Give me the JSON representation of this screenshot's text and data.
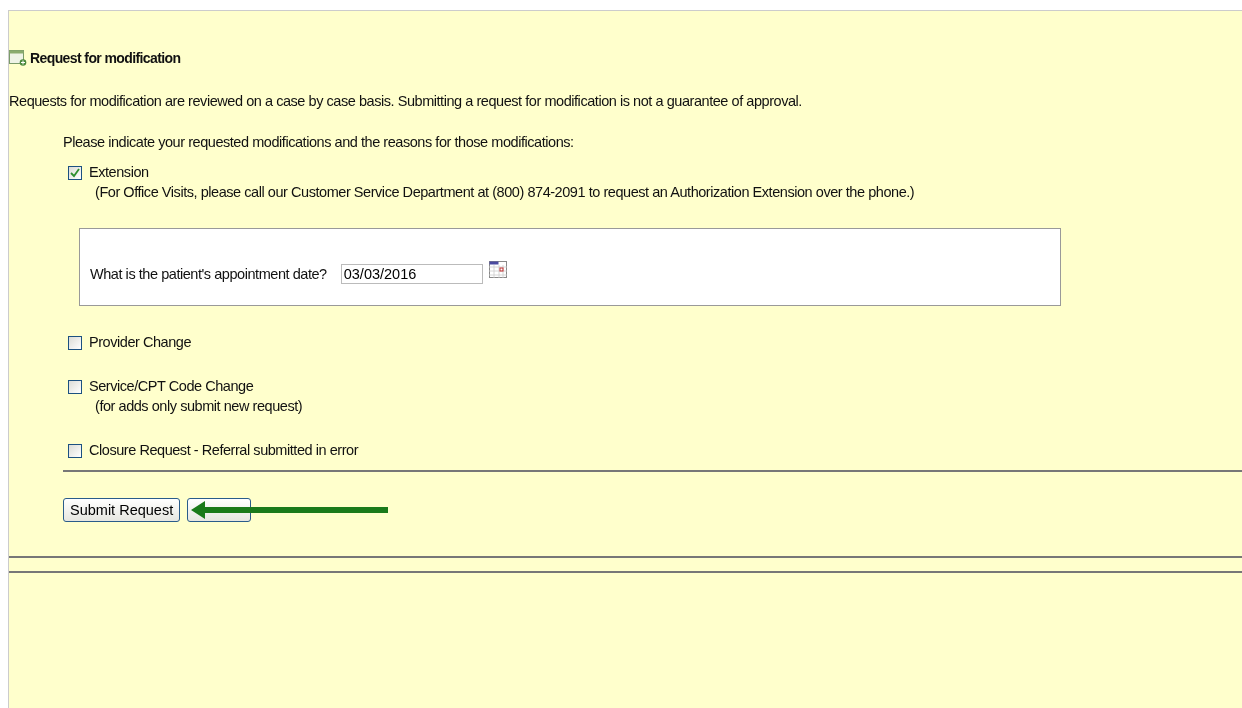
{
  "panel": {
    "title": "Request for modification"
  },
  "intro": "Requests for modification are reviewed on a case by case basis. Submitting a request for modification is not a guarantee of approval.",
  "instruction": "Please indicate your requested modifications and the reasons for those modifications:",
  "options": [
    {
      "label": "Extension",
      "checked": true,
      "note": "(For Office Visits, please call our Customer Service Department at (800) 874-2091 to request an Authorization Extension over the phone.)",
      "detail": {
        "question": "What is the patient's appointment date?",
        "date": "03/03/2016"
      }
    },
    {
      "label": "Provider Change",
      "checked": false
    },
    {
      "label": "Service/CPT Code Change",
      "checked": false,
      "note": "(for adds only submit new request)"
    },
    {
      "label": "Closure Request - Referral submitted in error",
      "checked": false
    }
  ],
  "buttons": [
    "Submit Request"
  ]
}
